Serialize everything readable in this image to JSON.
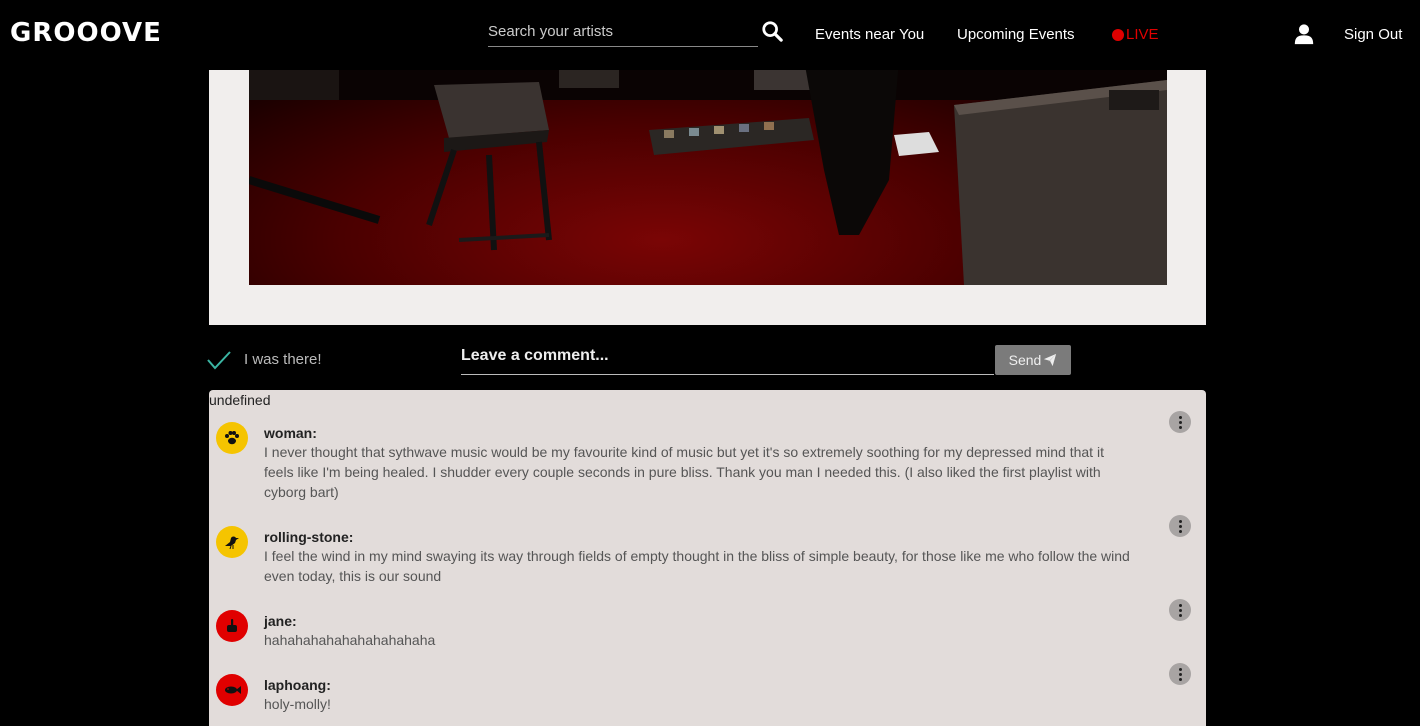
{
  "header": {
    "logo": "GROOOVE",
    "search": {
      "placeholder": "Search your artists",
      "value": ""
    },
    "nav": {
      "events_near_you": "Events near You",
      "upcoming_events": "Upcoming Events",
      "live": "LIVE"
    },
    "sign_out": "Sign Out",
    "icons": {
      "search": "search-icon",
      "user": "user-icon"
    }
  },
  "actions": {
    "was_there": "I was there!",
    "comment": {
      "placeholder": "Leave a comment...",
      "value": ""
    },
    "send_label": "Send"
  },
  "comments": {
    "heading": "undefined",
    "items": [
      {
        "author": "woman:",
        "avatar_icon": "paw-icon",
        "avatar_color": "#f5c400",
        "text": "I never thought that sythwave music would be my favourite kind of music but yet it's so extremely soothing for my depressed mind that it feels like I'm being healed. I shudder every couple seconds in pure bliss. Thank you man I needed this. (I also liked the first playlist with cyborg bart)"
      },
      {
        "author": "rolling-stone:",
        "avatar_icon": "crow-icon",
        "avatar_color": "#f5c400",
        "text": "I feel the wind in my mind swaying its way through fields of empty thought in the bliss of simple beauty, for those like me who follow the wind even today, this is our sound"
      },
      {
        "author": "jane:",
        "avatar_icon": "hand-icon",
        "avatar_color": "#e00000",
        "text": "hahahahahahahahahahaha"
      },
      {
        "author": "laphoang:",
        "avatar_icon": "fish-icon",
        "avatar_color": "#e00000",
        "text": "holy-molly!"
      }
    ]
  },
  "colors": {
    "live": "#e00000",
    "check": "#3bb5a3",
    "panel": "#e2dcda",
    "frame": "#f1eeed"
  }
}
